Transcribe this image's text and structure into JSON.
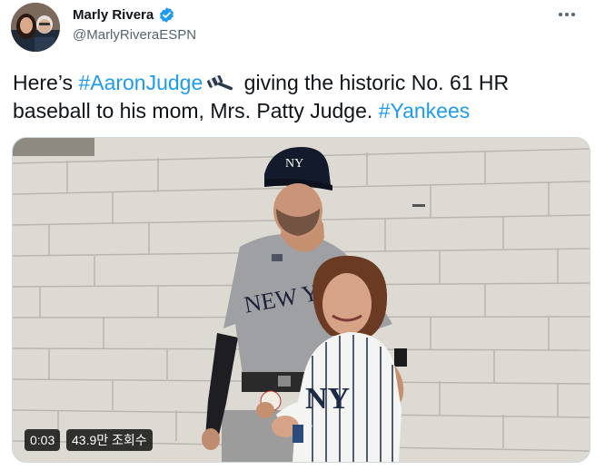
{
  "author": {
    "display_name": "Marly Rivera",
    "handle": "@MarlyRiveraESPN",
    "verified": true,
    "avatar_icon": "avatar-photo"
  },
  "more_icon": "more-horizontal-icon",
  "tweet": {
    "text_1": "Here’s ",
    "hashtag_1": "#AaronJudge",
    "emoji": "gavel-emoji",
    "text_2": " giving the historic No. 61 HR baseball to his mom, Mrs. Patty Judge. ",
    "hashtag_2": "#Yankees"
  },
  "video": {
    "elapsed": "0:03",
    "views": "43.9만 조회수",
    "jersey_lettering": "NEW YORK"
  },
  "colors": {
    "link": "#1d9bf0",
    "secondary_text": "#536471",
    "verified": "#1d9bf0"
  }
}
